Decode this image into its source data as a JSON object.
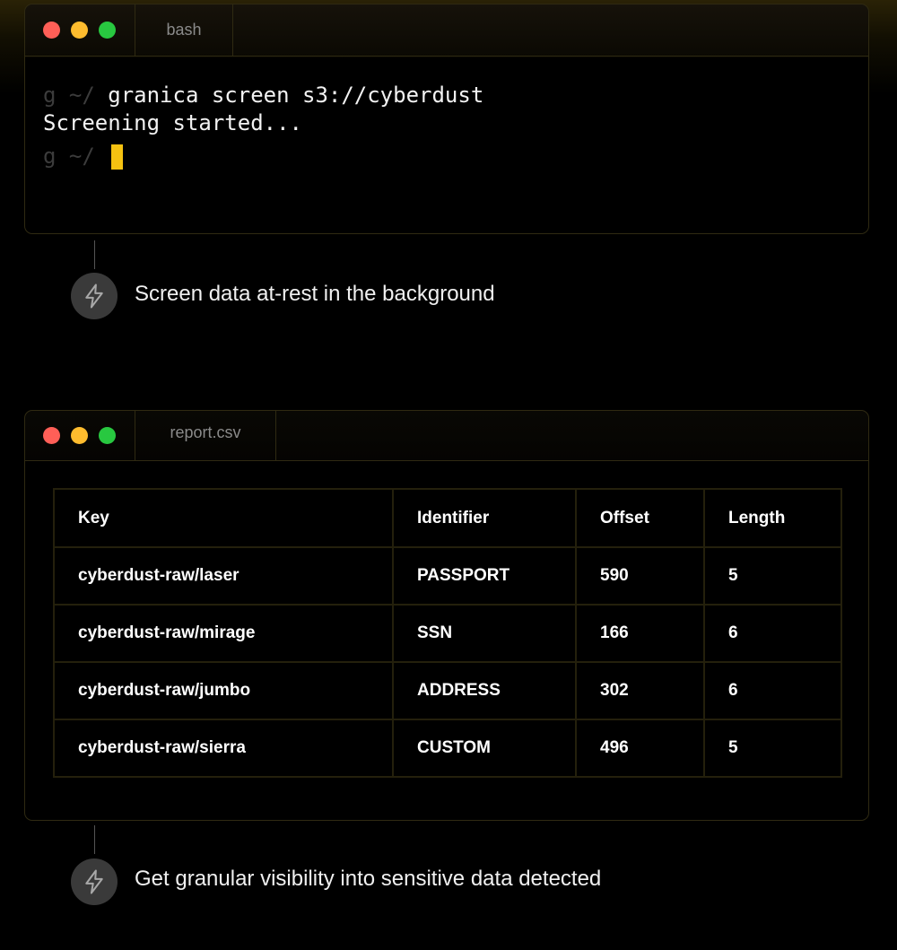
{
  "bash_window": {
    "tab_label": "bash",
    "lines": [
      {
        "prompt": "g ~/ ",
        "text": "granica screen s3://cyberdust"
      },
      {
        "prompt": "",
        "text": "Screening started..."
      },
      {
        "prompt": "g ~/ ",
        "text": ""
      }
    ]
  },
  "steps": [
    {
      "icon": "lightning-icon",
      "text": "Screen data at-rest in the background"
    },
    {
      "icon": "lightning-icon",
      "text": "Get granular visibility into sensitive data detected"
    }
  ],
  "report_window": {
    "tab_label": "report.csv",
    "table": {
      "headers": [
        "Key",
        "Identifier",
        "Offset",
        "Length"
      ],
      "rows": [
        [
          "cyberdust-raw/laser",
          "PASSPORT",
          "590",
          "5"
        ],
        [
          "cyberdust-raw/mirage",
          "SSN",
          "166",
          "6"
        ],
        [
          "cyberdust-raw/jumbo",
          "ADDRESS",
          "302",
          "6"
        ],
        [
          "cyberdust-raw/sierra",
          "CUSTOM",
          "496",
          "5"
        ]
      ]
    }
  },
  "colors": {
    "close": "#ff5f57",
    "minimize": "#febc2e",
    "maximize": "#28c840",
    "cursor": "#f5c211",
    "border": "#2f2a12"
  }
}
